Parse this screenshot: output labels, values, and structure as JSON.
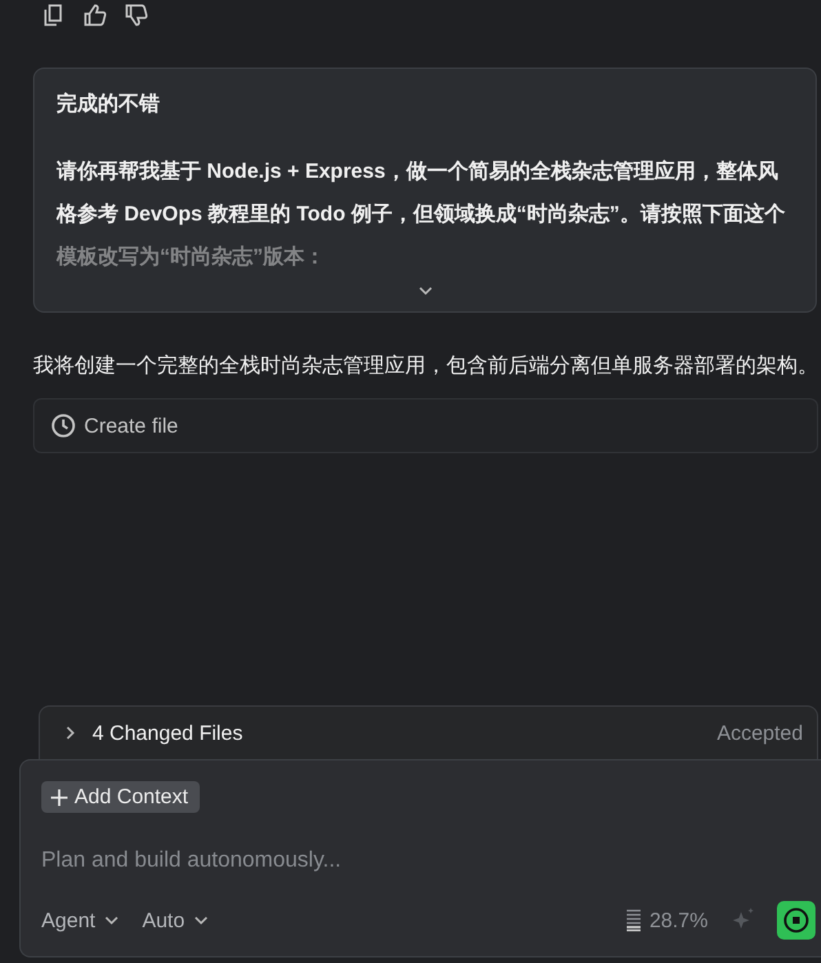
{
  "user_message": {
    "title": "完成的不错",
    "body": "请你再帮我基于 Node.js + Express，做一个简易的全栈杂志管理应用，整体风格参考 DevOps 教程里的 Todo 例子，但领域换成“时尚杂志”。请按照下面这个模板改写为“时尚杂志”版本：",
    "collapsed": true
  },
  "assistant_message": {
    "text": "我将创建一个完整的全栈时尚杂志管理应用，包含前后端分离但单服务器部署的架构。",
    "tool_call": "Create file"
  },
  "changes": {
    "label": "4 Changed Files",
    "status": "Accepted",
    "expanded": false
  },
  "composer": {
    "add_context": "Add Context",
    "placeholder": "Plan and build autonomously...",
    "mode": "Agent",
    "model": "Auto",
    "context_usage": "28.7%"
  }
}
